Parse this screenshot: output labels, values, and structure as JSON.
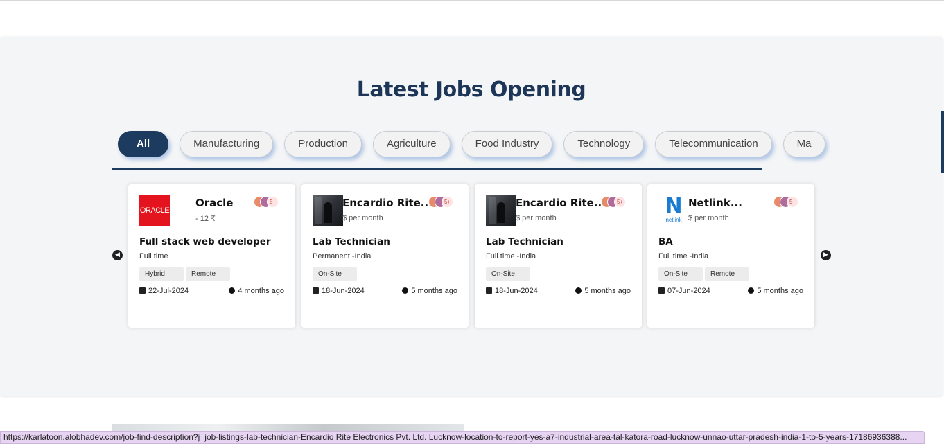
{
  "section": {
    "title": "Latest Jobs Opening"
  },
  "categories": [
    "All",
    "Manufacturing",
    "Production",
    "Agriculture",
    "Food Industry",
    "Technology",
    "Telecommunication",
    "Ma"
  ],
  "navigation": {
    "prev_icon": "chevron-left-icon",
    "next_icon": "chevron-right-icon"
  },
  "jobs": [
    {
      "company": "Oracle",
      "salary": "- 12 ₹",
      "logo": "ORACLE",
      "avatars_more": "5+",
      "title": "Full stack web developer",
      "type": "Full time",
      "tags": [
        "Hybrid",
        "Remote"
      ],
      "date": "22-Jul-2024",
      "posted": "4 months ago"
    },
    {
      "company": "Encardio Rite...",
      "salary": "$ per month",
      "avatars_more": "5+",
      "title": "Lab Technician",
      "type": "Permanent -India",
      "tags": [
        "On-Site"
      ],
      "date": "18-Jun-2024",
      "posted": "5 months ago"
    },
    {
      "company": "Encardio Rite...",
      "salary": "$ per month",
      "avatars_more": "5+",
      "title": "Lab Technician",
      "type": "Full time -India",
      "tags": [
        "On-Site"
      ],
      "date": "18-Jun-2024",
      "posted": "5 months ago"
    },
    {
      "company": "Netlink...",
      "salary": "$ per month",
      "logo_letter": "N",
      "logo_text": "netlink",
      "avatars_more": "5+",
      "title": "BA",
      "type": "Full time -India",
      "tags": [
        "On-Site",
        "Remote"
      ],
      "date": "07-Jun-2024",
      "posted": "5 months ago"
    }
  ],
  "status_url": "https://karlatoon.alobhadev.com/job-find-description?j=job-listings-lab-technician-Encardio Rite Electronics Pvt. Ltd. Lucknow-location-to-report-yes-a7-industrial-area-tal-katora-road-lucknow-unnao-uttar-pradesh-india-1-to-5-years-17186936388...",
  "colors": {
    "primary": "#1d3a5f",
    "tab_shadow": "#5a8cd2",
    "oracle_red": "#e3141d",
    "netlink_blue": "#1a7bd0",
    "status_bg": "#e7d4f3"
  }
}
